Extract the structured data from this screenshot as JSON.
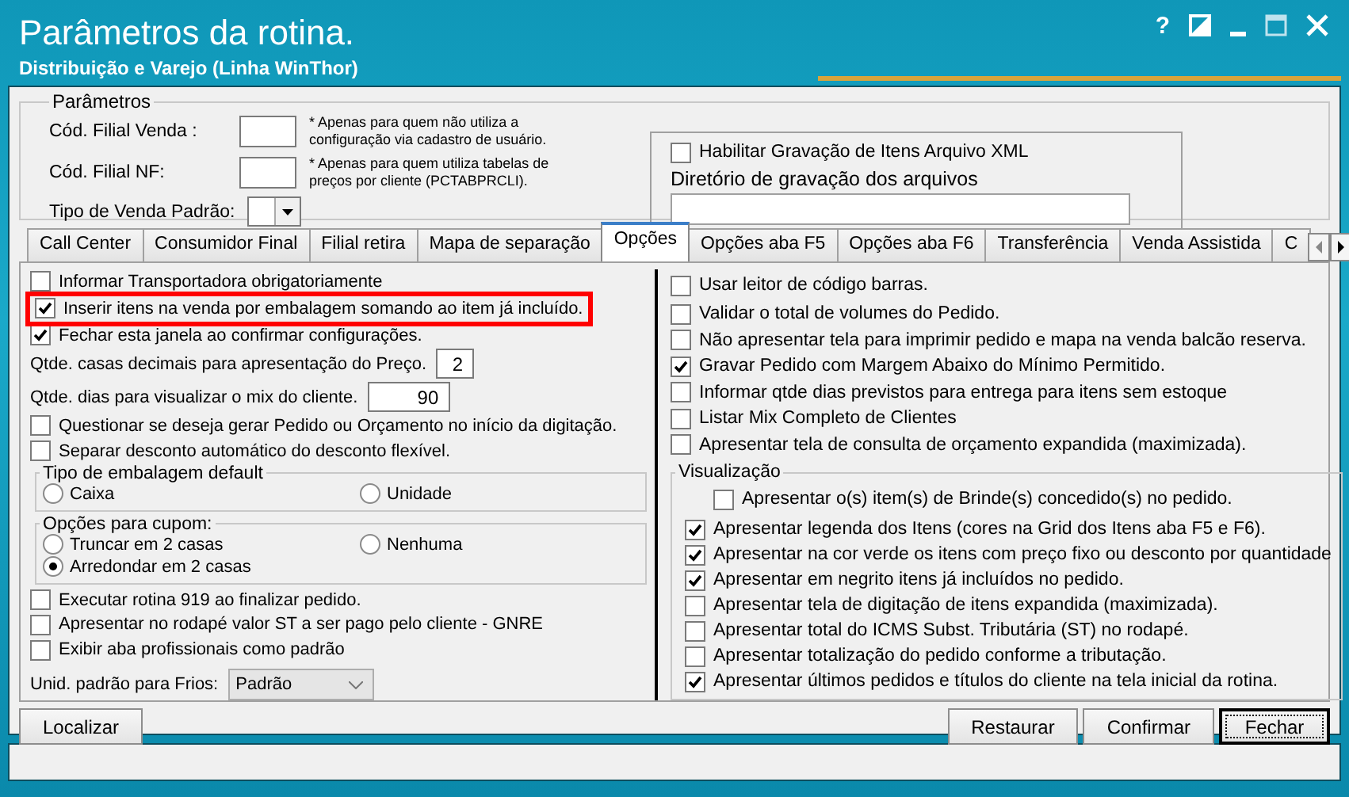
{
  "window": {
    "title": "Parâmetros da rotina.",
    "subtitle": "Distribuição e Varejo (Linha WinThor)",
    "help": "?"
  },
  "parametros": {
    "title": "Parâmetros",
    "fields": [
      {
        "label": "Cód. Filial Venda :",
        "note": "* Apenas para quem não utiliza a configuração via cadastro de usuário."
      },
      {
        "label": "Cód. Filial NF:",
        "note": "* Apenas para quem utiliza tabelas de preços por cliente (PCTABPRCLI)."
      }
    ],
    "tipo_venda": {
      "label": "Tipo de Venda Padrão:"
    },
    "xml": {
      "label": "Habilitar Gravação de Itens Arquivo XML",
      "checked": false
    },
    "diretorio": {
      "label": "Diretório de gravação dos arquivos"
    }
  },
  "tabs": [
    {
      "label": "Call Center",
      "selected": false
    },
    {
      "label": "Consumidor Final",
      "selected": false
    },
    {
      "label": "Filial retira",
      "selected": false
    },
    {
      "label": "Mapa de separação",
      "selected": false
    },
    {
      "label": "Opções",
      "selected": true
    },
    {
      "label": "Opções aba F5",
      "selected": false
    },
    {
      "label": "Opções aba F6",
      "selected": false
    },
    {
      "label": "Transferência",
      "selected": false
    },
    {
      "label": "Venda Assistida",
      "selected": false
    },
    {
      "label": "C",
      "selected": false
    }
  ],
  "left_options": [
    {
      "kind": "checkbox",
      "label": "Informar Transportadora obrigatoriamente",
      "checked": false,
      "highlighted": false
    },
    {
      "kind": "checkbox",
      "label": "Inserir itens na venda por embalagem somando ao item já incluído.",
      "checked": true,
      "highlighted": true
    },
    {
      "kind": "checkbox",
      "label": "Fechar esta janela ao confirmar configurações.",
      "checked": true,
      "highlighted": false
    },
    {
      "kind": "number",
      "label": "Qtde. casas decimais para apresentação do Preço.",
      "value": "2"
    },
    {
      "kind": "number",
      "label": "Qtde. dias para visualizar o mix do cliente.",
      "value": "90"
    },
    {
      "kind": "checkbox",
      "label": "Questionar se deseja gerar Pedido ou Orçamento no início da digitação.",
      "checked": false,
      "highlighted": false
    },
    {
      "kind": "checkbox",
      "label": "Separar desconto automático do desconto flexível.",
      "checked": false,
      "highlighted": false
    },
    {
      "kind": "radio_group",
      "title": "Tipo de embalagem default",
      "options": [
        {
          "label": "Caixa",
          "selected": false
        },
        {
          "label": "Unidade",
          "selected": false
        }
      ]
    },
    {
      "kind": "radio_group",
      "title": "Opções para cupom:",
      "options": [
        {
          "label": "Truncar em 2 casas",
          "selected": false
        },
        {
          "label": "Arredondar em 2 casas",
          "selected": true
        },
        {
          "label": "Nenhuma",
          "selected": false
        }
      ]
    },
    {
      "kind": "checkbox",
      "label": "Executar rotina 919 ao finalizar pedido.",
      "checked": false,
      "highlighted": false
    },
    {
      "kind": "checkbox",
      "label": "Apresentar no rodapé valor ST a ser pago pelo cliente - GNRE",
      "checked": false,
      "highlighted": false
    },
    {
      "kind": "checkbox",
      "label": "Exibir aba profissionais como padrão",
      "checked": false,
      "highlighted": false
    },
    {
      "kind": "select",
      "label": "Unid. padrão para Frios:",
      "value": "Padrão"
    }
  ],
  "right_options": [
    {
      "label": "Usar leitor de código barras.",
      "checked": false
    },
    {
      "label": "Validar o total de volumes do Pedido.",
      "checked": false
    },
    {
      "label": "Não apresentar tela para imprimir pedido e mapa na venda balcão reserva.",
      "checked": false
    },
    {
      "label": "Gravar Pedido com Margem Abaixo do Mínimo Permitido.",
      "checked": true
    },
    {
      "label": "Informar qtde dias previstos para entrega para itens sem estoque",
      "checked": false
    },
    {
      "label": "Listar Mix Completo de Clientes",
      "checked": false
    },
    {
      "label": "Apresentar tela de consulta de orçamento expandida (maximizada).",
      "checked": false
    }
  ],
  "visualizacao": {
    "title": "Visualização",
    "options": [
      {
        "label": "Apresentar o(s) item(s) de Brinde(s) concedido(s) no pedido.",
        "checked": false
      },
      {
        "label": "Apresentar legenda dos Itens (cores na Grid dos Itens aba F5 e F6).",
        "checked": true
      },
      {
        "label": "Apresentar na cor verde os itens com preço fixo ou desconto por quantidade",
        "checked": true
      },
      {
        "label": "Apresentar em negrito itens já incluídos no pedido.",
        "checked": true
      },
      {
        "label": "Apresentar tela de digitação de itens expandida (maximizada).",
        "checked": false
      },
      {
        "label": "Apresentar total do ICMS Subst. Tributária (ST) no rodapé.",
        "checked": false
      },
      {
        "label": "Apresentar totalização do pedido conforme a tributação.",
        "checked": false
      },
      {
        "label": "Apresentar últimos pedidos e títulos do cliente na tela inicial da rotina.",
        "checked": true
      }
    ]
  },
  "buttons": {
    "left": [
      "Localizar"
    ],
    "right": [
      {
        "label": "Restaurar",
        "focused": false
      },
      {
        "label": "Confirmar",
        "focused": false
      },
      {
        "label": "Fechar",
        "focused": true
      }
    ]
  }
}
